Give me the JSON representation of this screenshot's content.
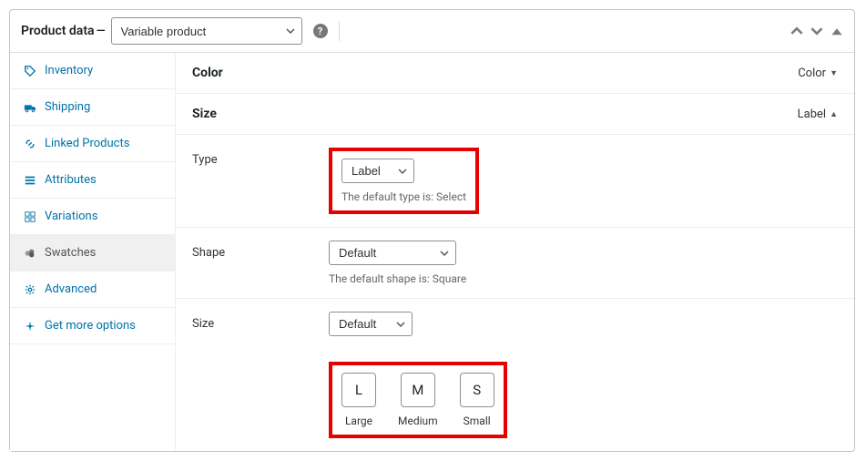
{
  "header": {
    "title": "Product data",
    "type_selected": "Variable product"
  },
  "sidebar": {
    "items": [
      {
        "label": "Inventory"
      },
      {
        "label": "Shipping"
      },
      {
        "label": "Linked Products"
      },
      {
        "label": "Attributes"
      },
      {
        "label": "Variations"
      },
      {
        "label": "Swatches"
      },
      {
        "label": "Advanced"
      },
      {
        "label": "Get more options"
      }
    ]
  },
  "attributes": {
    "color": {
      "name": "Color",
      "meta_label": "Color"
    },
    "size": {
      "name": "Size",
      "meta_label": "Label"
    }
  },
  "fields": {
    "type": {
      "label": "Type",
      "value": "Label",
      "hint": "The default type is: Select"
    },
    "shape": {
      "label": "Shape",
      "value": "Default",
      "hint": "The default shape is: Square"
    },
    "size": {
      "label": "Size",
      "value": "Default"
    }
  },
  "swatches": [
    {
      "letter": "L",
      "label": "Large"
    },
    {
      "letter": "M",
      "label": "Medium"
    },
    {
      "letter": "S",
      "label": "Small"
    }
  ]
}
